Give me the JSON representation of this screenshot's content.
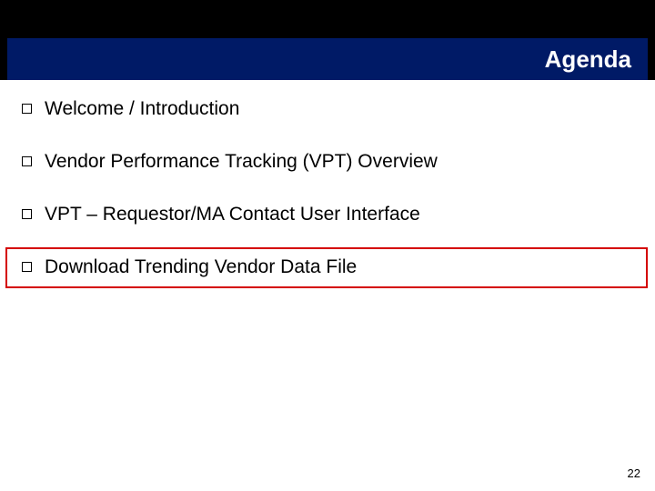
{
  "title": "Agenda",
  "items": [
    {
      "label": "Welcome / Introduction"
    },
    {
      "label": "Vendor Performance Tracking (VPT) Overview"
    },
    {
      "label": "VPT – Requestor/MA Contact User Interface"
    },
    {
      "label": "Download Trending Vendor Data File"
    }
  ],
  "highlighted_index": 3,
  "page_number": "22"
}
